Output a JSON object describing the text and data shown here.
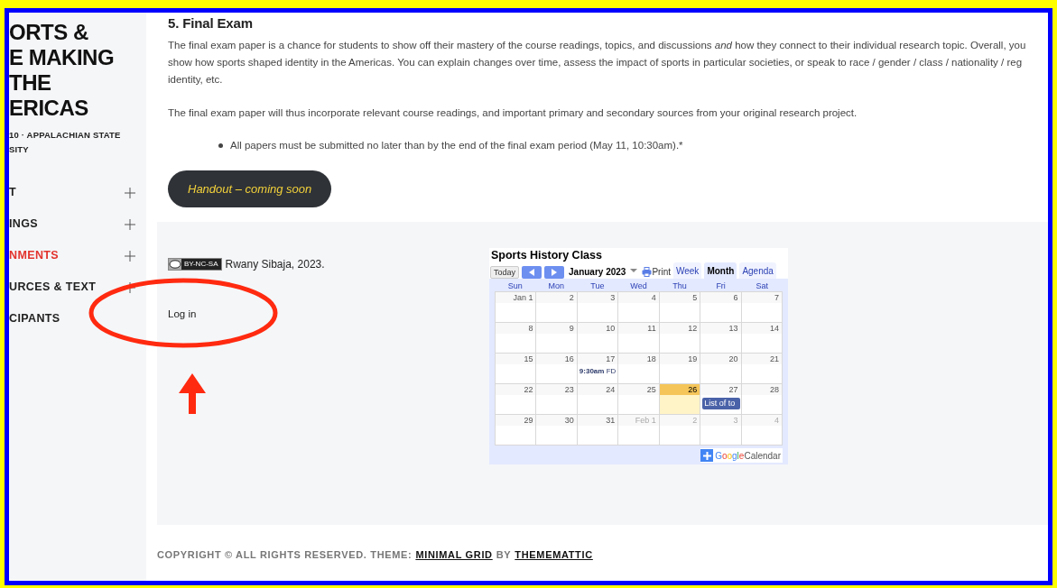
{
  "sidebar": {
    "title_lines": [
      "ORTS &",
      "E MAKING",
      "THE",
      "ERICAS"
    ],
    "subtitle_lines": [
      "10 · APPALACHIAN STATE",
      "SITY"
    ],
    "menu": [
      {
        "label": "T",
        "selected": false,
        "has_submenu": true
      },
      {
        "label": "INGS",
        "selected": false,
        "has_submenu": true
      },
      {
        "label": "NMENTS",
        "selected": true,
        "has_submenu": true
      },
      {
        "label": "URCES & TEXT",
        "selected": false,
        "has_submenu": true
      },
      {
        "label": "CIPANTS",
        "selected": false,
        "has_submenu": false
      }
    ]
  },
  "content": {
    "heading": "5. Final Exam",
    "paragraph_lines": [
      "The final exam paper is a chance for students to show off their mastery of the course readings, topics, and discussions *and* how they connect to their individual research topic. Overall, you",
      "show how sports shaped identity in the Americas. You can explain changes over time, assess the impact of sports in particular societies, or speak to race / gender / class / nationality / reg",
      "identity, etc."
    ],
    "paragraph": "The final exam paper will thus incorporate relevant course readings, and important primary and secondary sources from your original research project.",
    "bullets": [
      "All papers must be submitted no later than by the end of the final exam period (May 11, 10:30am).*"
    ],
    "button": "Handout – coming soon"
  },
  "footer_widgets": {
    "license_badge": "BY-NC-SA",
    "credit": "Rwany Sibaja, 2023.",
    "login": "Log in"
  },
  "calendar": {
    "title": "Sports History Class",
    "today_button": "Today",
    "month": "January 2023",
    "print": "Print",
    "views": [
      {
        "label": "Week",
        "selected": false
      },
      {
        "label": "Month",
        "selected": true
      },
      {
        "label": "Agenda",
        "selected": false
      }
    ],
    "weekdays": [
      "Sun",
      "Mon",
      "Tue",
      "Wed",
      "Thu",
      "Fri",
      "Sat"
    ],
    "weeks": [
      [
        {
          "day": "Jan 1",
          "other_month": false,
          "today": false
        },
        {
          "day": "2",
          "other_month": false,
          "today": false
        },
        {
          "day": "3",
          "other_month": false,
          "today": false
        },
        {
          "day": "4",
          "other_month": false,
          "today": false
        },
        {
          "day": "5",
          "other_month": false,
          "today": false
        },
        {
          "day": "6",
          "other_month": false,
          "today": false
        },
        {
          "day": "7",
          "other_month": false,
          "today": false
        }
      ],
      [
        {
          "day": "8",
          "other_month": false,
          "today": false
        },
        {
          "day": "9",
          "other_month": false,
          "today": false
        },
        {
          "day": "10",
          "other_month": false,
          "today": false
        },
        {
          "day": "11",
          "other_month": false,
          "today": false
        },
        {
          "day": "12",
          "other_month": false,
          "today": false
        },
        {
          "day": "13",
          "other_month": false,
          "today": false
        },
        {
          "day": "14",
          "other_month": false,
          "today": false
        }
      ],
      [
        {
          "day": "15",
          "other_month": false,
          "today": false
        },
        {
          "day": "16",
          "other_month": false,
          "today": false
        },
        {
          "day": "17",
          "other_month": false,
          "today": false,
          "event": {
            "kind": "timed",
            "time": "9:30am",
            "title": "FD"
          }
        },
        {
          "day": "18",
          "other_month": false,
          "today": false
        },
        {
          "day": "19",
          "other_month": false,
          "today": false
        },
        {
          "day": "20",
          "other_month": false,
          "today": false
        },
        {
          "day": "21",
          "other_month": false,
          "today": false
        }
      ],
      [
        {
          "day": "22",
          "other_month": false,
          "today": false
        },
        {
          "day": "23",
          "other_month": false,
          "today": false
        },
        {
          "day": "24",
          "other_month": false,
          "today": false
        },
        {
          "day": "25",
          "other_month": false,
          "today": false
        },
        {
          "day": "26",
          "other_month": false,
          "today": true
        },
        {
          "day": "27",
          "other_month": false,
          "today": false,
          "event": {
            "kind": "chip",
            "title": "List of to"
          }
        },
        {
          "day": "28",
          "other_month": false,
          "today": false
        }
      ],
      [
        {
          "day": "29",
          "other_month": false,
          "today": false
        },
        {
          "day": "30",
          "other_month": false,
          "today": false
        },
        {
          "day": "31",
          "other_month": false,
          "today": false
        },
        {
          "day": "Feb 1",
          "other_month": true,
          "today": false
        },
        {
          "day": "2",
          "other_month": true,
          "today": false
        },
        {
          "day": "3",
          "other_month": true,
          "today": false
        },
        {
          "day": "4",
          "other_month": true,
          "today": false
        }
      ]
    ],
    "brand": "Google",
    "brand_suffix": "Calendar"
  },
  "copyright": {
    "text": "COPYRIGHT © ALL RIGHTS RESERVED. THEME:",
    "theme_link": "MINIMAL GRID",
    "by": "BY",
    "author_link": "THEMEMATTIC"
  }
}
